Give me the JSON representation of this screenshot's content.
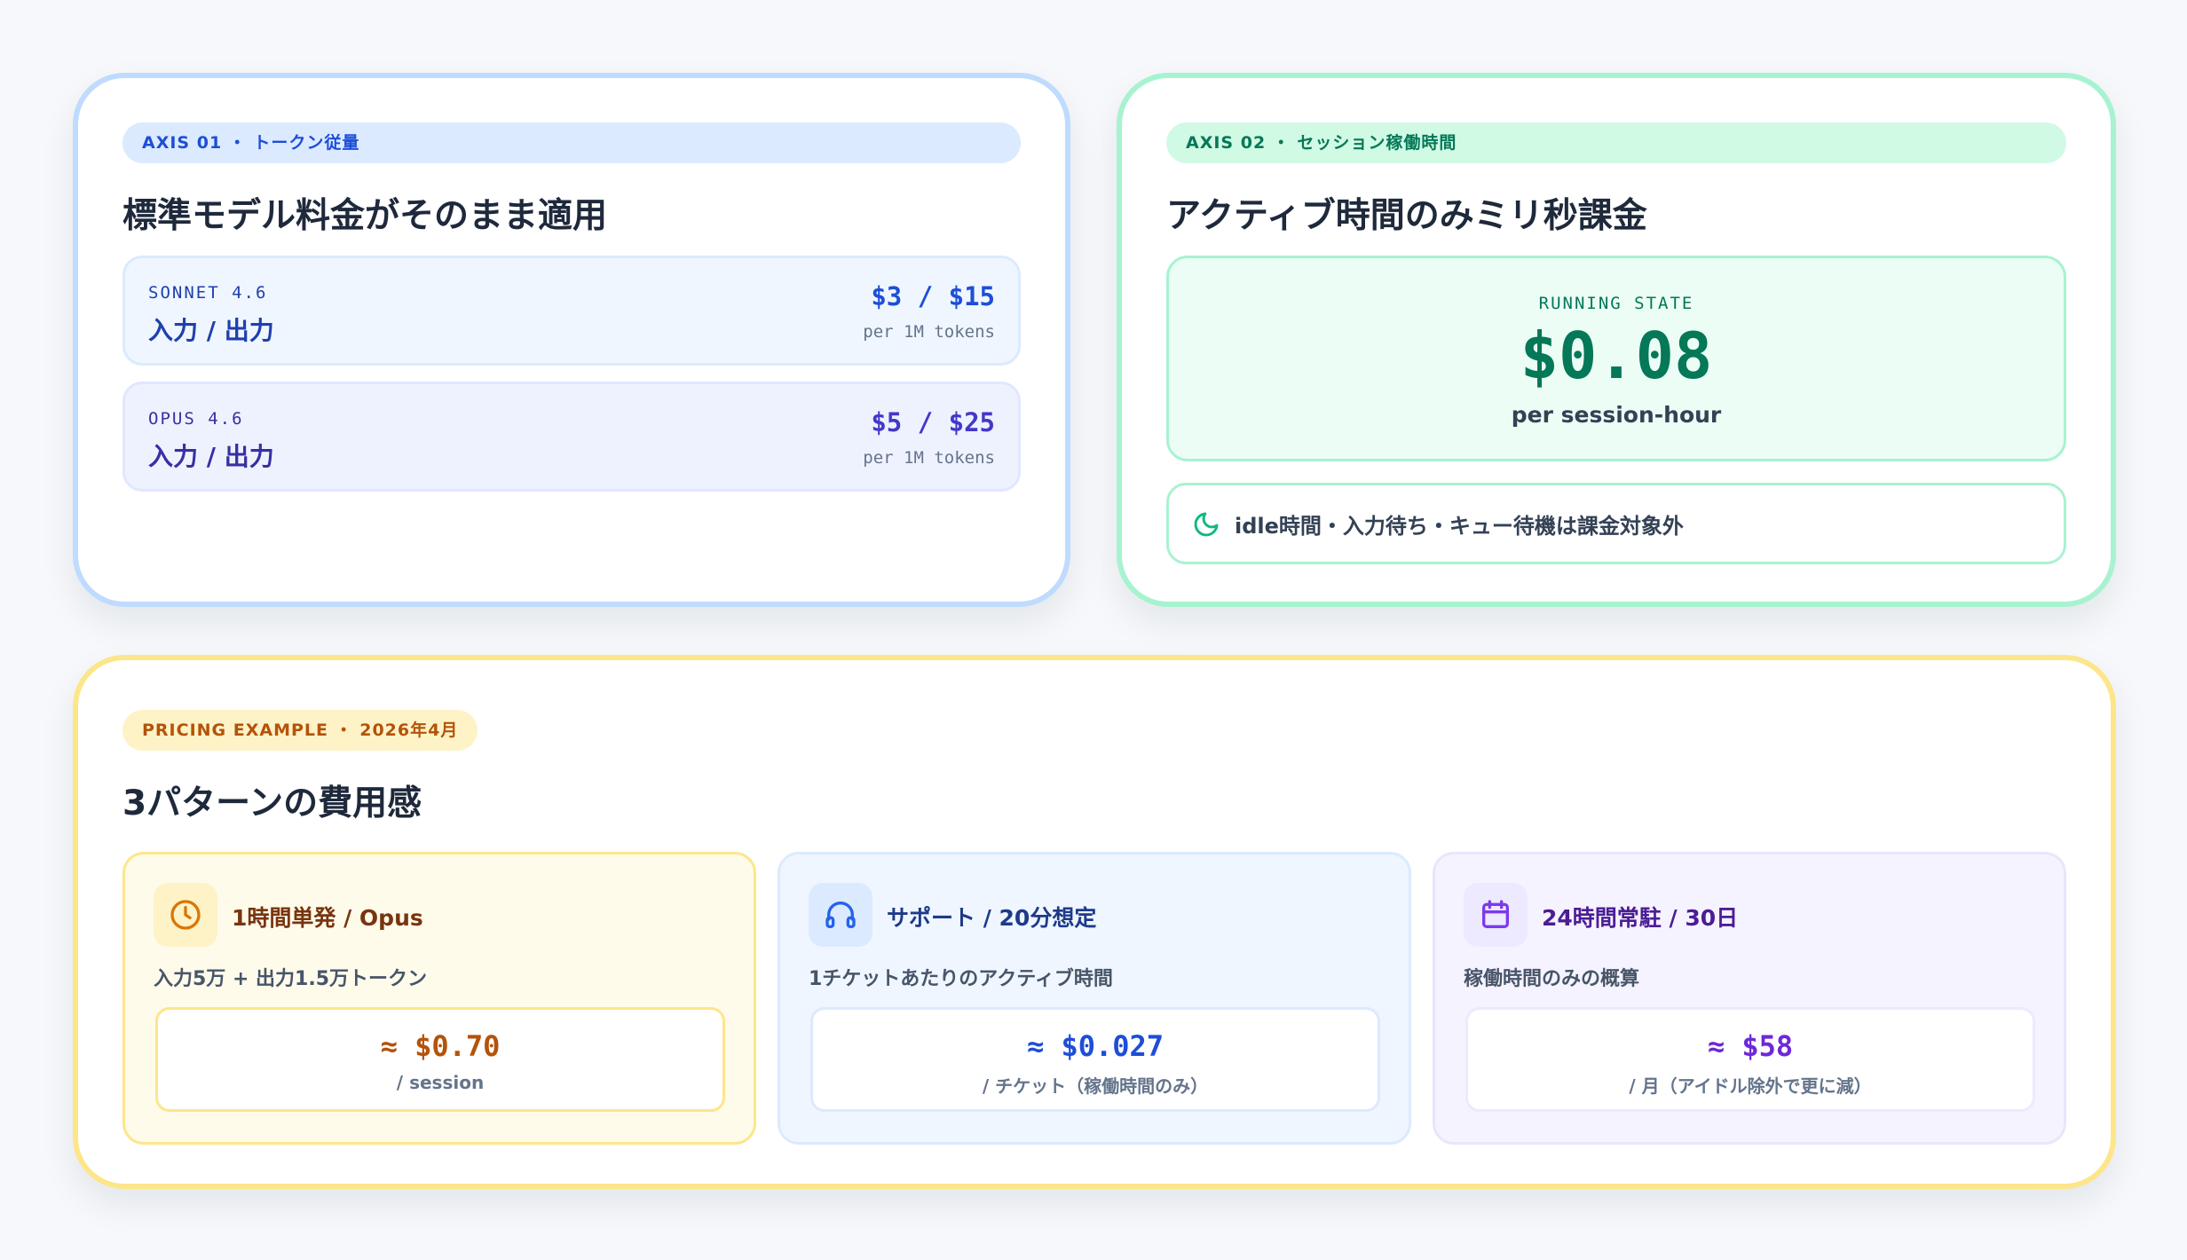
{
  "axis01": {
    "tag": "AXIS 01 ・ トークン従量",
    "title": "標準モデル料金がそのまま適用",
    "models": [
      {
        "name": "SONNET 4.6",
        "io": "入力 / 出力",
        "price": "$3 / $15",
        "unit": "per 1M tokens"
      },
      {
        "name": "OPUS 4.6",
        "io": "入力 / 出力",
        "price": "$5 / $25",
        "unit": "per 1M tokens"
      }
    ]
  },
  "axis02": {
    "tag": "AXIS 02 ・ セッション稼働時間",
    "title": "アクティブ時間のみミリ秒課金",
    "running_label": "RUNNING STATE",
    "running_value": "$0.08",
    "running_unit": "per session-hour",
    "idle_note": "idle時間・入力待ち・キュー待機は課金対象外"
  },
  "pricing_example": {
    "tag": "PRICING EXAMPLE ・ 2026年4月",
    "title": "3パターンの費用感",
    "cases": [
      {
        "icon": "clock-icon",
        "title": "1時間単発 / Opus",
        "desc": "入力5万 + 出力1.5万トークン",
        "value": "≈ $0.70",
        "unit": "/ session"
      },
      {
        "icon": "headset-icon",
        "title": "サポート / 20分想定",
        "desc": "1チケットあたりのアクティブ時間",
        "value": "≈ $0.027",
        "unit": "/ チケット（稼働時間のみ）"
      },
      {
        "icon": "calendar-icon",
        "title": "24時間常駐 / 30日",
        "desc": "稼働時間のみの概算",
        "value": "≈ $58",
        "unit": "/ 月（アイドル除外で更に減）"
      }
    ]
  },
  "colors": {
    "blue_accent": "#1d4ed8",
    "green_accent": "#047857",
    "amber_accent": "#b45309",
    "violet_accent": "#6d28d9"
  }
}
